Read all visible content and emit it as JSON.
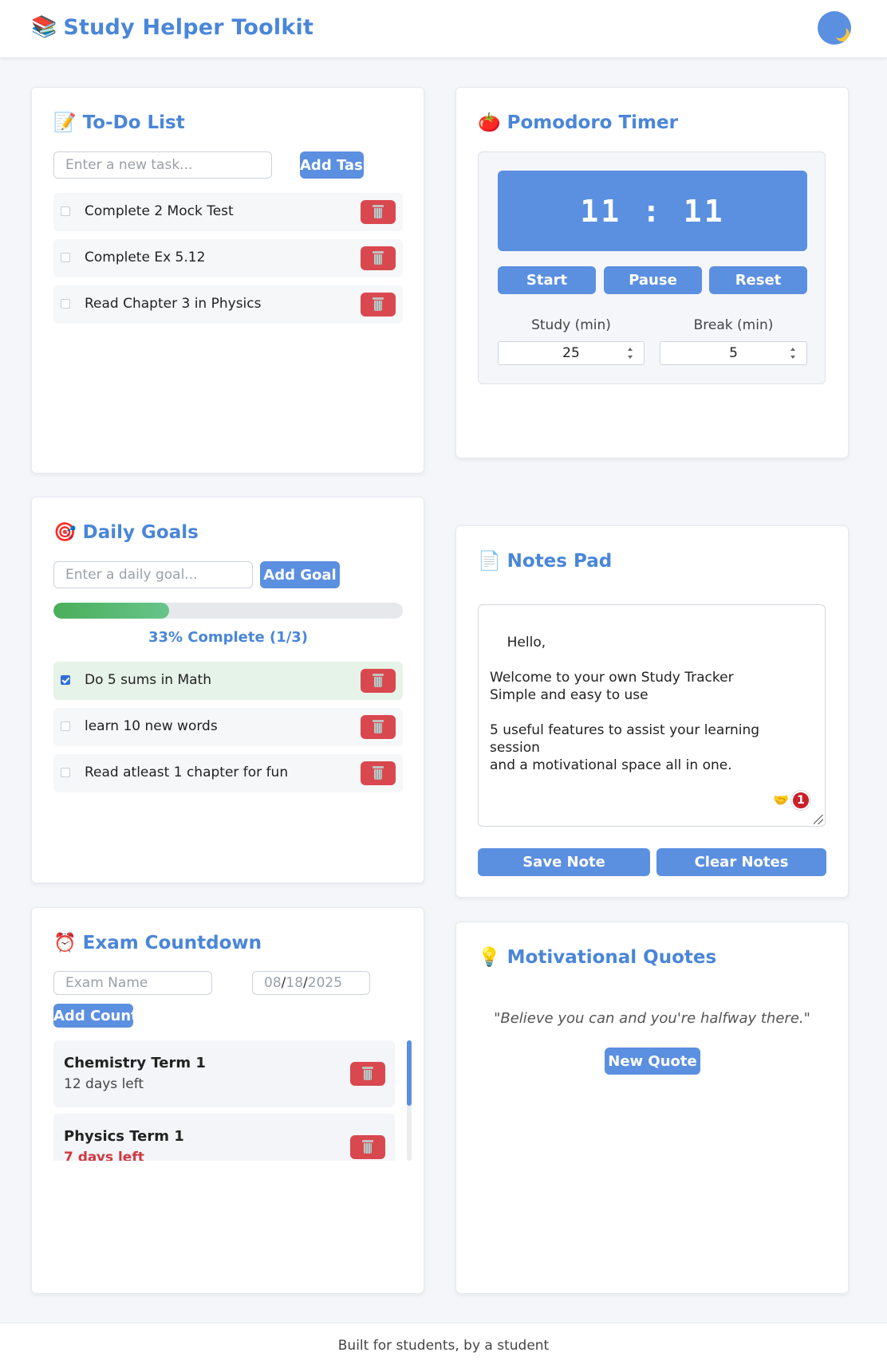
{
  "app": {
    "icon": "books-icon",
    "title": "Study Helper Toolkit"
  },
  "todo": {
    "icon": "📝",
    "title": "To-Do List",
    "input_placeholder": "Enter a new task...",
    "add_label": "Add Task",
    "items": [
      {
        "label": "Complete 2 Mock Test",
        "done": false
      },
      {
        "label": "Complete Ex 5.12",
        "done": false
      },
      {
        "label": "Read Chapter 3 in Physics",
        "done": false
      }
    ]
  },
  "pomodoro": {
    "icon": "🍅",
    "title": "Pomodoro Timer",
    "display": "11:11",
    "start_label": "Start",
    "pause_label": "Pause",
    "reset_label": "Reset",
    "study_label": "Study (min)",
    "study_value": "25",
    "break_label": "Break (min)",
    "break_value": "5"
  },
  "goals": {
    "icon": "🎯",
    "title": "Daily Goals",
    "input_placeholder": "Enter a daily goal...",
    "add_label": "Add Goal",
    "progress_percent": 33,
    "progress_text": "33% Complete (1/3)",
    "items": [
      {
        "label": "Do 5 sums in Math",
        "done": true
      },
      {
        "label": "learn 10 new words",
        "done": false
      },
      {
        "label": "Read atleast 1 chapter for fun",
        "done": false
      }
    ]
  },
  "notes": {
    "icon": "📄",
    "title": "Notes Pad",
    "text": "Hello,\n\nWelcome to your own Study Tracker\nSimple and easy to use\n\n5 useful features to assist your learning session\nand a motivational space all in one.",
    "badge": "1",
    "save_label": "Save Note",
    "clear_label": "Clear Notes"
  },
  "exam": {
    "icon": "⏰",
    "title": "Exam Countdown",
    "name_placeholder": "Exam Name",
    "date_mm": "08",
    "date_dd": "18",
    "date_yyyy": "2025",
    "add_label": "Add Countdown",
    "items": [
      {
        "name": "Chemistry Term 1",
        "days": "12 days left"
      },
      {
        "name": "Physics Term 1",
        "days": "7 days left"
      }
    ]
  },
  "quotes": {
    "icon": "💡",
    "title": "Motivational Quotes",
    "quote": "\"Believe you can and you're halfway there.\"",
    "button_label": "New Quote"
  },
  "footer": {
    "text": "Built for students, by a student"
  },
  "colors": {
    "accent": "#4a86d8",
    "button": "#5b8fe0",
    "danger": "#d9484f",
    "progress": "#4aae5a"
  }
}
